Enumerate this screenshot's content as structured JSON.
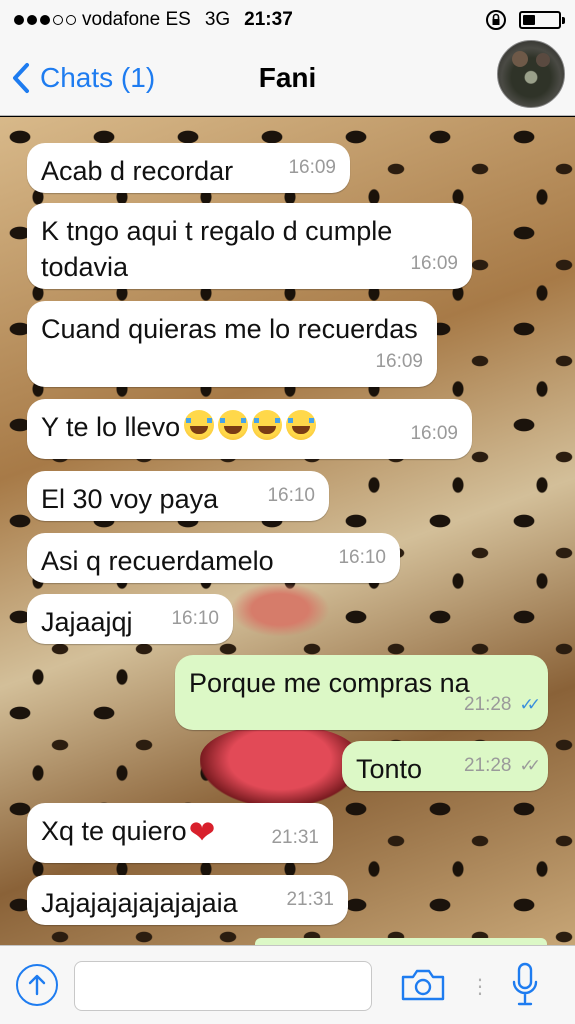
{
  "status_bar": {
    "carrier": "vodafone ES",
    "network": "3G",
    "time": "21:37",
    "signal_bars_filled": 3,
    "signal_bars_total": 5,
    "battery_level": 0.35
  },
  "nav": {
    "back_label": "Chats (1)",
    "title": "Fani"
  },
  "messages": [
    {
      "dir": "in",
      "text": "Acab d recordar",
      "time": "16:09"
    },
    {
      "dir": "in",
      "text": "K tngo aqui t regalo d cumple todavia",
      "time": "16:09"
    },
    {
      "dir": "in",
      "text": "Cuand quieras me lo recuerdas",
      "time": "16:09"
    },
    {
      "dir": "in",
      "text": "Y te lo llevo",
      "time": "16:09",
      "emoji": "😂😂😂😂"
    },
    {
      "dir": "in",
      "text": "El 30 voy paya",
      "time": "16:10"
    },
    {
      "dir": "in",
      "text": "Asi q recuerdamelo",
      "time": "16:10"
    },
    {
      "dir": "in",
      "text": "Jajaajqj",
      "time": "16:10"
    },
    {
      "dir": "out",
      "text": "Porque me compras na",
      "time": "21:28",
      "ticks": "read"
    },
    {
      "dir": "out",
      "text": "Tonto",
      "time": "21:28",
      "ticks": "delivered"
    },
    {
      "dir": "in",
      "text": "Xq te quiero",
      "time": "21:31",
      "emoji": "❤️"
    },
    {
      "dir": "in",
      "text": "Jajajajajajajajaia",
      "time": "21:31"
    }
  ],
  "input": {
    "placeholder": ""
  },
  "colors": {
    "accent": "#1e7cf0",
    "incoming_bubble": "#ffffff",
    "outgoing_bubble": "#dcf8c6",
    "read_ticks": "#3a8fdc"
  },
  "icons": [
    "back-chevron-icon",
    "lock-rotation-icon",
    "battery-icon",
    "upload-arrow-icon",
    "camera-icon",
    "microphone-icon"
  ]
}
